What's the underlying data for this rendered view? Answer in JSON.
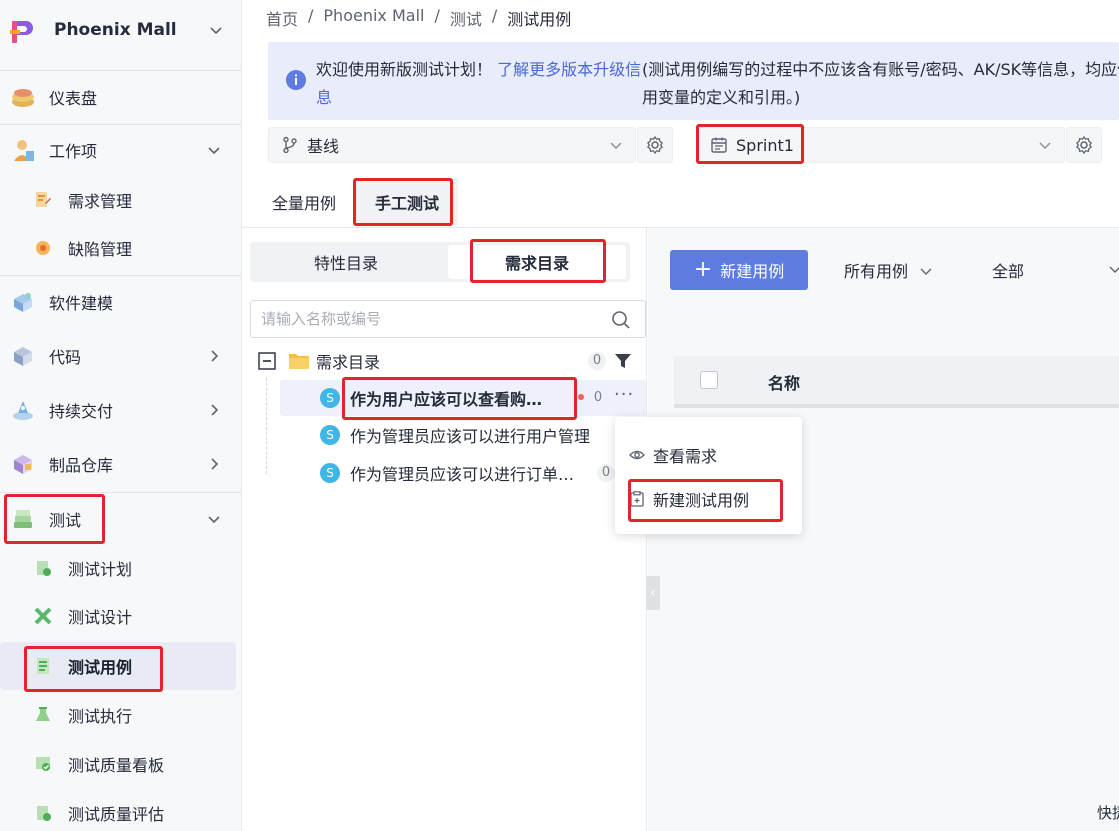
{
  "sidebar": {
    "brand": "Phoenix Mall",
    "items": [
      {
        "label": "仪表盘"
      },
      {
        "label": "工作项"
      },
      {
        "label": "需求管理"
      },
      {
        "label": "缺陷管理"
      },
      {
        "label": "软件建模"
      },
      {
        "label": "代码"
      },
      {
        "label": "持续交付"
      },
      {
        "label": "制品仓库"
      },
      {
        "label": "测试"
      },
      {
        "label": "测试计划"
      },
      {
        "label": "测试设计"
      },
      {
        "label": "测试用例"
      },
      {
        "label": "测试执行"
      },
      {
        "label": "测试质量看板"
      },
      {
        "label": "测试质量评估"
      }
    ]
  },
  "breadcrumb": [
    "首页",
    "/",
    "Phoenix Mall",
    "/",
    "测试",
    "/",
    "测试用例"
  ],
  "notice": {
    "text": "欢迎使用新版测试计划！",
    "link": "了解更多版本升级信息",
    "detail": "(测试用例编写的过程中不应该含有账号/密码、AK/SK等信息，均应使用变量的定义和引用。)"
  },
  "baseline_select": {
    "label": "基线"
  },
  "sprint_select": {
    "label": "Sprint1"
  },
  "tabs": [
    {
      "label": "全量用例"
    },
    {
      "label": "手工测试"
    }
  ],
  "tree": {
    "segments": [
      {
        "label": "特性目录"
      },
      {
        "label": "需求目录"
      }
    ],
    "search_placeholder": "请输入名称或编号",
    "root": {
      "label": "需求目录",
      "count": "0"
    },
    "children": [
      {
        "badge": "S",
        "label": "作为用户应该可以查看购…",
        "count": "0"
      },
      {
        "badge": "S",
        "label": "作为管理员应该可以进行用户管理"
      },
      {
        "badge": "S",
        "label": "作为管理员应该可以进行订单…",
        "count": "0"
      }
    ]
  },
  "context_menu": {
    "items": [
      {
        "label": "查看需求"
      },
      {
        "label": "新建测试用例"
      }
    ]
  },
  "right_pane": {
    "new_button": "新建用例",
    "filter_all_cases": "所有用例",
    "filter_all": "全部",
    "col_name": "名称",
    "corner_text": "快捷"
  },
  "colors": {
    "primary": "#5e7ce0",
    "highlight_red": "#e0262a",
    "badge_blue": "#3fb6e5",
    "notice_bg": "#e9ecfa"
  }
}
